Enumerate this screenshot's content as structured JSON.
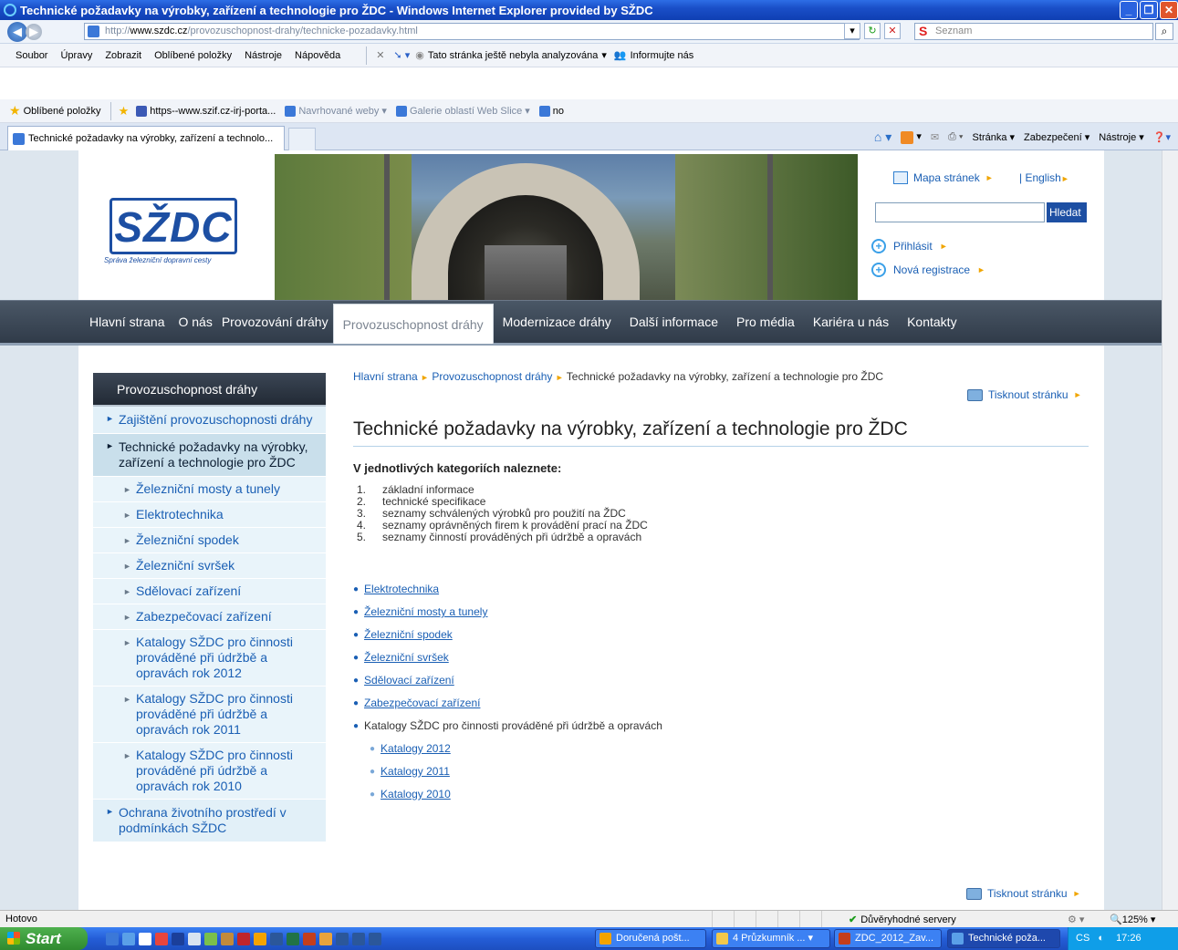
{
  "window": {
    "title": "Technické požadavky na výrobky, zařízení a technologie pro ŽDC - Windows Internet Explorer provided by SŽDC"
  },
  "address": {
    "url_prefix": "http://",
    "url_host": "www.szdc.cz",
    "url_path": "/provozuschopnost-drahy/technicke-pozadavky.html",
    "search_provider": "Seznam"
  },
  "menu": {
    "items": [
      "Soubor",
      "Úpravy",
      "Zobrazit",
      "Oblíbené položky",
      "Nástroje",
      "Nápověda"
    ],
    "analysis": "Tato stránka ještě nebyla analyzována",
    "inform": "Informujte nás"
  },
  "favorites": {
    "label": "Oblíbené položky",
    "items": [
      "https--www.szif.cz-irj-porta...",
      "Navrhované weby",
      "Galerie oblastí Web Slice",
      "no"
    ]
  },
  "tab": {
    "title": "Technické požadavky na výrobky, zařízení a technolo..."
  },
  "commands": {
    "page": "Stránka",
    "security": "Zabezpečení",
    "tools": "Nástroje"
  },
  "header": {
    "logo": "SŽDC",
    "logo_sub": "Správa železniční dopravní cesty",
    "sitemap": "Mapa stránek",
    "english": "| English",
    "search_button": "Hledat",
    "login": "Přihlásit",
    "register": "Nová registrace"
  },
  "nav": {
    "items": [
      "Hlavní strana",
      "O nás",
      "Provozování dráhy",
      "Provozuschopnost dráhy",
      "Modernizace dráhy",
      "Další informace",
      "Pro média",
      "Kariéra u nás",
      "Kontakty"
    ],
    "active": "Provozuschopnost dráhy"
  },
  "sidebar": {
    "title": "Provozuschopnost dráhy",
    "item1": "Zajištění provozuschopnosti dráhy",
    "item2": "Technické požadavky na výrobky, zařízení a technologie pro ŽDC",
    "subitems": [
      "Železniční mosty a tunely",
      "Elektrotechnika",
      "Železniční spodek",
      "Železniční svršek",
      "Sdělovací zařízení",
      "Zabezpečovací zařízení",
      "Katalogy SŽDC pro činnosti prováděné při údržbě a opravách rok 2012",
      "Katalogy SŽDC pro činnosti prováděné při údržbě a opravách rok 2011",
      "Katalogy SŽDC pro činnosti prováděné při údržbě a opravách rok 2010"
    ],
    "item3": "Ochrana životního prostředí v podmínkách SŽDC"
  },
  "content": {
    "breadcrumb": [
      "Hlavní strana",
      "Provozuschopnost dráhy",
      "Technické požadavky na výrobky, zařízení a technologie pro ŽDC"
    ],
    "print": "Tisknout stránku",
    "title": "Technické požadavky na výrobky, zařízení a technologie pro ŽDC",
    "subheading": "V jednotlivých kategoriích naleznete:",
    "list": [
      "základní informace",
      "technické specifikace",
      "seznamy schválených výrobků pro použití na ŽDC",
      "seznamy oprávněných firem k provádění prací na ŽDC",
      "seznamy činností prováděných při údržbě a opravách"
    ],
    "links": [
      "Elektrotechnika",
      "Železniční mosty a tunely",
      "Železniční spodek",
      "Železniční svršek",
      "Sdělovací zařízení",
      "Zabezpečovací zařízení"
    ],
    "catalog_label": "Katalogy SŽDC pro činnosti prováděné při údržbě a opravách",
    "catalogs": [
      "Katalogy 2012",
      "Katalogy 2011",
      "Katalogy 2010"
    ]
  },
  "status": {
    "text": "Hotovo",
    "zone": "Důvěryhodné servery",
    "zoom": "125%"
  },
  "taskbar": {
    "start": "Start",
    "tasks": [
      "Doručená pošt...",
      "4 Průzkumník ...",
      "ZDC_2012_Zav...",
      "Technické poža..."
    ],
    "lang": "CS",
    "time": "17:26"
  }
}
